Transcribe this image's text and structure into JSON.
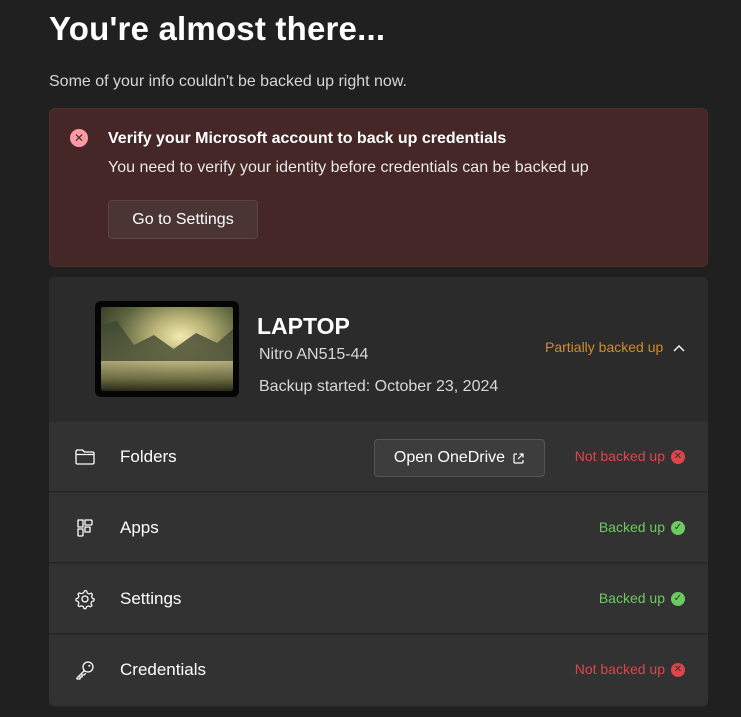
{
  "page": {
    "title": "You're almost there...",
    "subtitle": "Some of your info couldn't be backed up right now."
  },
  "alert": {
    "icon": "error-icon",
    "icon_glyph": "✕",
    "title": "Verify your Microsoft account to back up credentials",
    "message": "You need to verify your identity before credentials can be backed up",
    "button_label": "Go to Settings",
    "color": "#442726"
  },
  "device": {
    "name": "LAPTOP",
    "model": "Nitro AN515-44",
    "backup_started": "Backup started: October 23, 2024",
    "status": "Partially backed up",
    "status_color": "#d08c2c",
    "expanded": true
  },
  "items": [
    {
      "label": "Folders",
      "icon": "folder-icon",
      "status": "Not backed up",
      "state": "error",
      "action_label": "Open OneDrive",
      "action_icon": "external-link-icon"
    },
    {
      "label": "Apps",
      "icon": "apps-icon",
      "status": "Backed up",
      "state": "ok"
    },
    {
      "label": "Settings",
      "icon": "gear-icon",
      "status": "Backed up",
      "state": "ok"
    },
    {
      "label": "Credentials",
      "icon": "key-icon",
      "status": "Not backed up",
      "state": "error"
    }
  ],
  "colors": {
    "error": "#e0444a",
    "success": "#6ccb5f",
    "background": "#202020"
  }
}
